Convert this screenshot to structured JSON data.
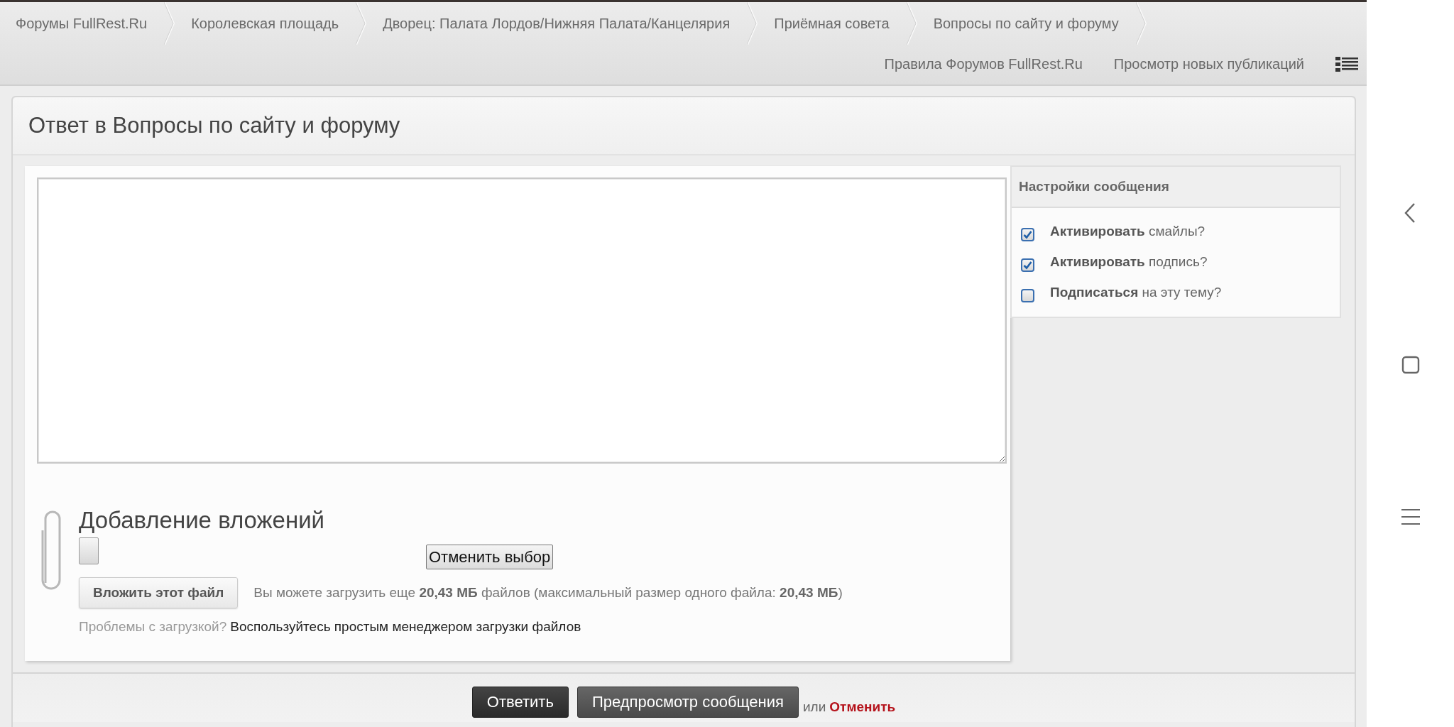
{
  "breadcrumbs": [
    {
      "label": "Форумы FullRest.Ru"
    },
    {
      "label": "Королевская площадь"
    },
    {
      "label": "Дворец: Палата Лордов/Нижняя Палата/Канцелярия"
    },
    {
      "label": "Приёмная совета"
    },
    {
      "label": "Вопросы по сайту и форуму"
    }
  ],
  "nav_links": [
    {
      "label": "Правила Форумов FullRest.Ru"
    },
    {
      "label": "Просмотр новых публикаций"
    }
  ],
  "form": {
    "title": "Ответ в Вопросы по сайту и форуму",
    "attachments": {
      "heading": "Добавление вложений",
      "cancel_selection_button": "Отменить выбор",
      "attach_button": "Вложить этот файл",
      "quota_text": "Вы можете загрузить еще **20,43 МБ** файлов (максимальный размер одного файла: **20,43 МБ**)",
      "problems_label": "Проблемы с загрузкой?",
      "simple_uploader_link": "Воспользуйтесь простым менеджером загрузки файлов"
    },
    "options": {
      "title": "Настройки сообщения",
      "items": [
        {
          "label": "**Активировать** смайлы?",
          "checked": true
        },
        {
          "label": "**Активировать** подпись?",
          "checked": true
        },
        {
          "label": "**Подписаться** на эту тему?",
          "checked": false
        }
      ]
    },
    "actions": {
      "submit_button": "Ответить",
      "preview_button": "Предпросмотр сообщения",
      "or_text": "или",
      "cancel_link": "Отменить"
    }
  }
}
